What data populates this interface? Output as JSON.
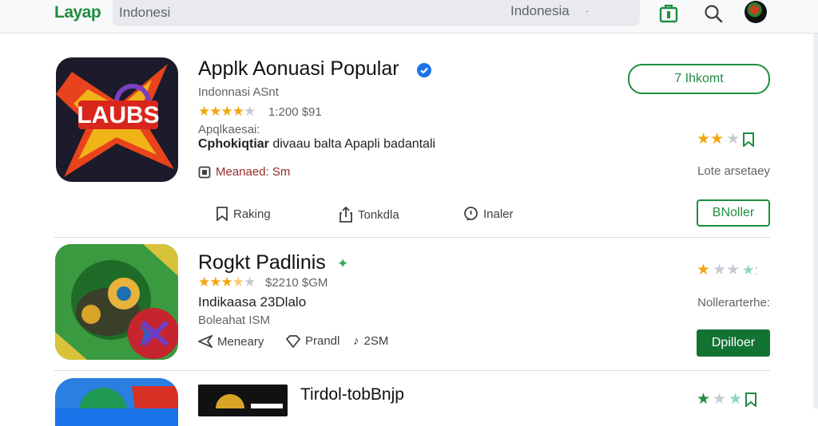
{
  "header": {
    "logo": "Layap",
    "search_value": "Indonesi",
    "region": "Indonesia",
    "region_arrow": "·"
  },
  "apps": [
    {
      "title": "Applk Aonuasi Popular",
      "badge": "verified-icon",
      "developer": "Indonnasi ASnt",
      "rating_stars": 4,
      "rating_text": "1:200 $91",
      "category": "Apqlkaesai:",
      "description_bold": "Cphokiqtiar",
      "description": "divaau balta Apapli badantali",
      "feature": "Meanaed: Sm",
      "install_label": "7 Ihkomt",
      "side_stars": 2,
      "side_note": "Lote arsetaey",
      "action_button": "BNoller",
      "actions": [
        "Raking",
        "Tonkdla",
        "Inaler"
      ]
    },
    {
      "title": "Rogkt Padlinis",
      "developer": "Indikaasa 23Dlalo",
      "rating_stars": 3.5,
      "rating_text": "$2210 $GM",
      "category": "Boleahat ISM",
      "side_stars": 1,
      "side_note": "Nollerarterhe:",
      "action_button": "Dpilloer",
      "actions": [
        "Meneary",
        "Prandl",
        "2SM"
      ]
    },
    {
      "title": "Tirdol-tobBnjp",
      "side_stars": 1
    }
  ],
  "colors": {
    "accent": "#1e8e3e",
    "button_fill": "#137333",
    "star": "#f2a60c",
    "star_off": "#c6cbd1",
    "verified": "#1a73e8"
  }
}
